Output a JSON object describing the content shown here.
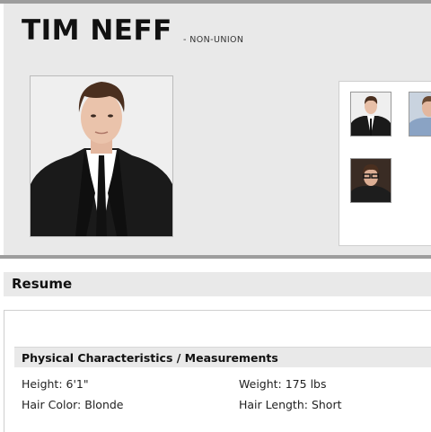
{
  "profile": {
    "name": "TIM NEFF",
    "union_status": "- NON-UNION"
  },
  "photos": {
    "main_alt": "Tim Neff headshot",
    "thumbnails": [
      "thumbnail-1",
      "thumbnail-2",
      "thumbnail-3"
    ]
  },
  "resume": {
    "title": "Resume",
    "section_title": "Physical Characteristics / Measurements",
    "attributes": [
      {
        "label": "Height",
        "value": "6'1\"",
        "text": "Height: 6'1\""
      },
      {
        "label": "Weight",
        "value": "175 lbs",
        "text": "Weight: 175 lbs"
      },
      {
        "label": "Hair Color",
        "value": "Blonde",
        "text": "Hair Color: Blonde"
      },
      {
        "label": "Hair Length",
        "value": "Short",
        "text": "Hair Length: Short"
      }
    ]
  },
  "colors": {
    "panel_bg": "#e9e9e9",
    "rule": "#9d9d9d",
    "text": "#111111"
  }
}
